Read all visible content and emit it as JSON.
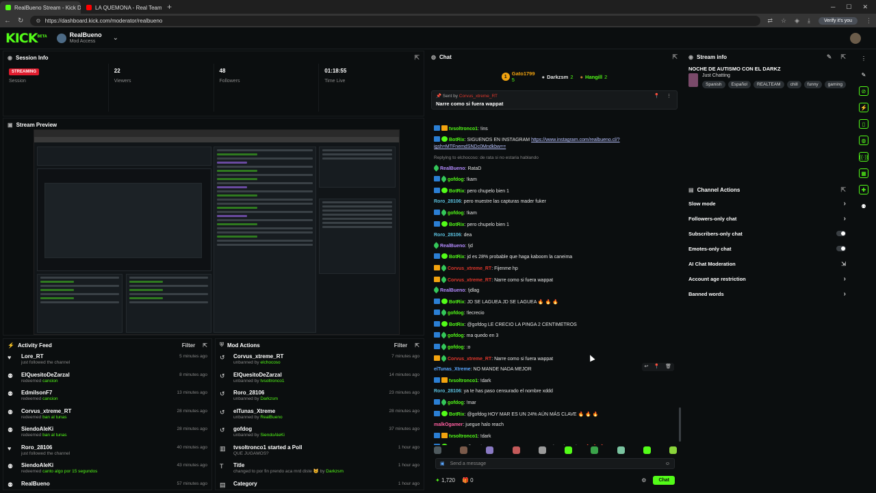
{
  "browser": {
    "tabs": [
      {
        "title": "RealBueno Stream - Kick Dashbo",
        "active": true,
        "favicon_color": "#53fc18"
      },
      {
        "title": "LA QUEMONA - Real Team IA Co",
        "active": false,
        "favicon_color": "#ff0000"
      }
    ],
    "url": "https://dashboard.kick.com/moderator/realbueno",
    "verify_label": "Verify it's you"
  },
  "app": {
    "logo": "KICK",
    "logo_sup": "BETA",
    "channel_name": "RealBueno",
    "channel_role": "Mod Access"
  },
  "session": {
    "title": "Session Info",
    "status_badge": "STREAMING",
    "status_label": "Session",
    "viewers": "22",
    "viewers_label": "Viewers",
    "followers": "48",
    "followers_label": "Followers",
    "time_live": "01:18:55",
    "time_live_label": "Time Live"
  },
  "preview": {
    "title": "Stream Preview"
  },
  "activity": {
    "title": "Activity Feed",
    "filter": "Filter",
    "items": [
      {
        "icon": "heart-icon",
        "name": "Lore_RT",
        "sub": "just followed the channel",
        "hl": "",
        "time": "5 minutes ago"
      },
      {
        "icon": "user-icon",
        "name": "ElQuesitoDeZarzal",
        "sub": "redeemed",
        "hl": "cancion",
        "time": "8 minutes ago"
      },
      {
        "icon": "user-icon",
        "name": "EdmilsonF7",
        "sub": "redeemed",
        "hl": "cancion",
        "time": "13 minutes ago"
      },
      {
        "icon": "user-icon",
        "name": "Corvus_xtreme_RT",
        "sub": "redeemed",
        "hl": "ban al tunas",
        "time": "28 minutes ago"
      },
      {
        "icon": "user-icon",
        "name": "SiendoAleKi",
        "sub": "redeemed",
        "hl": "ban al tunas",
        "time": "28 minutes ago"
      },
      {
        "icon": "heart-icon",
        "name": "Roro_28106",
        "sub": "just followed the channel",
        "hl": "",
        "time": "40 minutes ago"
      },
      {
        "icon": "user-icon",
        "name": "SiendoAleKi",
        "sub": "redeemed",
        "hl": "canto algo por 15 segundos",
        "time": "43 minutes ago"
      },
      {
        "icon": "user-icon",
        "name": "RealBueno",
        "sub": "",
        "hl": "",
        "time": "57 minutes ago"
      }
    ]
  },
  "modactions": {
    "title": "Mod Actions",
    "filter": "Filter",
    "items": [
      {
        "icon": "undo-icon",
        "name": "Corvus_xtreme_RT",
        "sub": "unbanned by",
        "hl": "elchocoso",
        "time": "7 minutes ago"
      },
      {
        "icon": "undo-icon",
        "name": "ElQuesitoDeZarzal",
        "sub": "unbanned by",
        "hl": "tvsoltronco1",
        "time": "14 minutes ago"
      },
      {
        "icon": "undo-icon",
        "name": "Roro_28106",
        "sub": "unbanned by",
        "hl": "Darkzsm",
        "time": "23 minutes ago"
      },
      {
        "icon": "undo-icon",
        "name": "elTunas_Xtreme",
        "sub": "unbanned by",
        "hl": "RealBueno",
        "time": "28 minutes ago"
      },
      {
        "icon": "undo-icon",
        "name": "gofdog",
        "sub": "unbanned by",
        "hl": "SiendoAleKi",
        "time": "37 minutes ago"
      },
      {
        "icon": "poll-icon",
        "name": "tvsoltronco1",
        "name_suffix": " started a Poll",
        "sub": "QUE JUGAMOS?",
        "hl": "",
        "time": "1 hour ago"
      },
      {
        "icon": "title-icon",
        "name": "Title",
        "sub": "changed to por fin prendo aca mrd diste 😺 by",
        "hl": "Darkzsm",
        "time": "1 hour ago"
      },
      {
        "icon": "category-icon",
        "name": "Category",
        "sub": "",
        "hl": "",
        "time": "1 hour ago"
      }
    ]
  },
  "chat": {
    "title": "Chat",
    "gifters": [
      {
        "rank": "1",
        "name": "Gato1799",
        "count": "5"
      },
      {
        "rank": "",
        "name": "Darkzsm",
        "count": "2"
      },
      {
        "rank": "",
        "name": "Hangill",
        "count": "2"
      }
    ],
    "pinned": {
      "sent_by": "Sent by",
      "user": "Corvus_xtreme_RT",
      "message": "Narre como si fuera wappat"
    },
    "messages": [
      {
        "badges": [
          "mod",
          "sub"
        ],
        "user": "tvsoltronco1",
        "color": "u-green",
        "text": ": !ins"
      },
      {
        "badges": [
          "mod",
          "bot"
        ],
        "user": "BotRix",
        "color": "u-green",
        "text": ": SIGUENOS EN INSTAGRAM ",
        "link": "https://www.instagram.com/realbueno.cl/?igsh=MTFnemdSNDc0Mndkbw=="
      },
      {
        "reply": "Replying to elchocoso: de rata si no estaria hablando"
      },
      {
        "badges": [
          "leaf"
        ],
        "user": "RealBueno",
        "color": "u-purple",
        "text": ": RataD"
      },
      {
        "badges": [
          "mod",
          "leaf"
        ],
        "user": "gofdog",
        "color": "u-green",
        "text": ": !kam"
      },
      {
        "badges": [
          "mod",
          "bot"
        ],
        "user": "BotRix",
        "color": "u-green",
        "text": ": pero chupelo bien 1"
      },
      {
        "badges": [],
        "user": "Roro_28106",
        "color": "u-cyan",
        "text": ": pero muestre las capturas mader fuker"
      },
      {
        "badges": [
          "mod",
          "leaf"
        ],
        "user": "gofdog",
        "color": "u-green",
        "text": ": !kam"
      },
      {
        "badges": [
          "mod",
          "bot"
        ],
        "user": "BotRix",
        "color": "u-green",
        "text": ": pero chupelo bien 1"
      },
      {
        "badges": [],
        "user": "Roro_28106",
        "color": "u-cyan",
        "text": ": dea"
      },
      {
        "badges": [
          "leaf"
        ],
        "user": "RealBueno",
        "color": "u-purple",
        "text": ": !jd"
      },
      {
        "badges": [
          "mod",
          "bot"
        ],
        "user": "BotRix",
        "color": "u-green",
        "text": ": jd es 28% probable que haga kaboom la caneima"
      },
      {
        "badges": [
          "sub",
          "leaf"
        ],
        "user": "Corvus_xtreme_RT",
        "color": "u-red",
        "text": ": Fijenme hp"
      },
      {
        "badges": [
          "sub",
          "leaf"
        ],
        "user": "Corvus_xtreme_RT",
        "color": "u-red",
        "text": ": Narre como si fuera wappat"
      },
      {
        "badges": [
          "leaf"
        ],
        "user": "RealBueno",
        "color": "u-purple",
        "text": ": !jdlag"
      },
      {
        "badges": [
          "mod",
          "bot"
        ],
        "user": "BotRix",
        "color": "u-green",
        "text": ": JD SE LAGUEA JD SE LAGUEA 🔥 🔥 🔥"
      },
      {
        "badges": [
          "mod",
          "leaf"
        ],
        "user": "gofdog",
        "color": "u-green",
        "text": ": !lecrecio"
      },
      {
        "badges": [
          "mod",
          "bot"
        ],
        "user": "BotRix",
        "color": "u-green",
        "text": ": @gofdog LE CRECIO LA PINGA 2 CENTIMETROS"
      },
      {
        "badges": [
          "mod",
          "leaf"
        ],
        "user": "gofdog",
        "color": "u-green",
        "text": ": ma quedo en 3"
      },
      {
        "badges": [
          "mod",
          "leaf"
        ],
        "user": "gofdog",
        "color": "u-green",
        "text": ": :o"
      },
      {
        "badges": [
          "sub",
          "leaf"
        ],
        "user": "Corvus_xtreme_RT",
        "color": "u-red",
        "text": ": Narre como si fuera wappat",
        "hover": true
      },
      {
        "badges": [],
        "user": "elTunas_Xtreme",
        "color": "u-blue",
        "text": ": NO MANDE NADA MEJOR"
      },
      {
        "badges": [
          "mod",
          "sub"
        ],
        "user": "tvsoltronco1",
        "color": "u-green",
        "text": ": !dark"
      },
      {
        "badges": [],
        "user": "Roro_28106",
        "color": "u-cyan",
        "text": ": ya te has paso censurado el nombre xddd"
      },
      {
        "badges": [
          "mod",
          "leaf"
        ],
        "user": "gofdog",
        "color": "u-green",
        "text": ": !mar"
      },
      {
        "badges": [
          "mod",
          "bot"
        ],
        "user": "BotRix",
        "color": "u-green",
        "text": ": @gofdog HOY MAR ES UN 24% AÚN MÁS CLAVE 🔥 🔥 🔥"
      },
      {
        "badges": [],
        "user": "malkOgamer",
        "color": "u-pink",
        "text": ": juegue halo reach"
      },
      {
        "badges": [
          "mod",
          "sub"
        ],
        "user": "tvsoltronco1",
        "color": "u-green",
        "text": ": !dark"
      },
      {
        "badges": [
          "mod",
          "bot"
        ],
        "user": "BotRix",
        "color": "u-green",
        "text": ": @tvsoltronco1 HOY DARK es un 96% aún más autista 🔥 🔥 🔥"
      }
    ],
    "input_placeholder": "Send a message",
    "points": "1,720",
    "count": "0",
    "send_label": "Chat"
  },
  "streaminfo": {
    "title": "Stream info",
    "stream_title": "NOCHE DE AUTISMO CON EL DARKZ",
    "category": "Just Chatting",
    "tags": [
      "Spanish",
      "Español",
      "REALTEAM",
      "chill",
      "funny",
      "gaming"
    ]
  },
  "channelactions": {
    "title": "Channel Actions",
    "items": [
      {
        "label": "Slow mode",
        "control": "chevron"
      },
      {
        "label": "Followers-only chat",
        "control": "chevron"
      },
      {
        "label": "Subscribers-only chat",
        "control": "toggle"
      },
      {
        "label": "Emotes-only chat",
        "control": "toggle"
      },
      {
        "label": "AI Chat Moderation",
        "control": "external"
      },
      {
        "label": "Account age restriction",
        "control": "chevron"
      },
      {
        "label": "Banned words",
        "control": "chevron"
      }
    ]
  },
  "colors": {
    "brand": "#53fc18",
    "live": "#e01c2e",
    "background": "#0b0e0f"
  }
}
